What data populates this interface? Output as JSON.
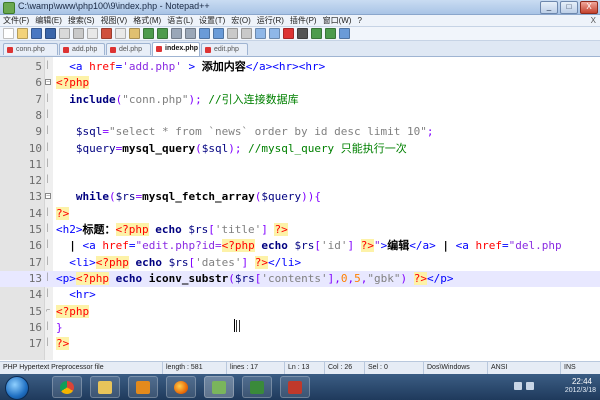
{
  "window": {
    "title": "C:\\wamp\\www\\php100\\9\\index.php - Notepad++",
    "buttons": {
      "minimize": "_",
      "maximize": "□",
      "close": "X"
    }
  },
  "menu": {
    "items": [
      "文件(F)",
      "编辑(E)",
      "搜索(S)",
      "视图(V)",
      "格式(M)",
      "语言(L)",
      "设置(T)",
      "宏(O)",
      "运行(R)",
      "插件(P)",
      "窗口(W)",
      "?"
    ],
    "close_label": "X"
  },
  "tabs": [
    {
      "label": "conn.php",
      "active": false
    },
    {
      "label": "add.php",
      "active": false
    },
    {
      "label": "del.php",
      "active": false
    },
    {
      "label": "index.php",
      "active": true
    },
    {
      "label": "edit.php",
      "active": false
    }
  ],
  "editor": {
    "current_line": 13,
    "lines": [
      {
        "n": "5",
        "segs": [
          [
            "t-tag",
            "  <a "
          ],
          [
            "t-attr",
            "href"
          ],
          [
            "t-tag",
            "="
          ],
          [
            "t-str",
            "'add.php'"
          ],
          [
            "t-tag",
            " > "
          ],
          [
            "t-txt",
            "添加内容"
          ],
          [
            "t-tag",
            "</a><hr><hr>"
          ]
        ]
      },
      {
        "n": "6",
        "segs": [
          [
            "t-php",
            "<?php"
          ]
        ]
      },
      {
        "n": "7",
        "segs": [
          [
            "t-kw",
            "  include"
          ],
          [
            "t-op",
            "("
          ],
          [
            "t-pstr",
            "\"conn.php\""
          ],
          [
            "t-op",
            ");"
          ],
          [
            "t-com",
            " //引入连接数据库"
          ]
        ]
      },
      {
        "n": "8",
        "segs": [
          [
            "",
            ""
          ]
        ]
      },
      {
        "n": "9",
        "segs": [
          [
            "t-var",
            "   $sql"
          ],
          [
            "t-op",
            "="
          ],
          [
            "t-pstr",
            "\"select * from `news` order by id desc limit 10\""
          ],
          [
            "t-op",
            ";"
          ]
        ]
      },
      {
        "n": "10",
        "segs": [
          [
            "t-var",
            "   $query"
          ],
          [
            "t-op",
            "="
          ],
          [
            "t-fn",
            "mysql_query"
          ],
          [
            "t-op",
            "("
          ],
          [
            "t-var",
            "$sql"
          ],
          [
            "t-op",
            ");"
          ],
          [
            "t-com",
            " //mysql_query 只能执行一次"
          ]
        ]
      },
      {
        "n": "11",
        "segs": [
          [
            "",
            ""
          ]
        ]
      },
      {
        "n": "12",
        "segs": [
          [
            "",
            ""
          ]
        ]
      },
      {
        "n": "13",
        "segs": [
          [
            "t-kw",
            "   while"
          ],
          [
            "t-op",
            "("
          ],
          [
            "t-var",
            "$rs"
          ],
          [
            "t-op",
            "="
          ],
          [
            "t-fn",
            "mysql_fetch_array"
          ],
          [
            "t-op",
            "("
          ],
          [
            "t-var",
            "$query"
          ],
          [
            "t-op",
            ")){"
          ]
        ]
      },
      {
        "n": "14",
        "segs": [
          [
            "t-php",
            "?>"
          ]
        ]
      },
      {
        "n": "15",
        "segs": [
          [
            "t-tag",
            "<h2>"
          ],
          [
            "t-txt",
            "标题："
          ],
          [
            "t-php",
            "<?php"
          ],
          [
            "t-kw",
            " echo "
          ],
          [
            "t-var",
            "$rs"
          ],
          [
            "t-op",
            "["
          ],
          [
            "t-pstr",
            "'title'"
          ],
          [
            "t-op",
            "] "
          ],
          [
            "t-php",
            "?>"
          ]
        ]
      },
      {
        "n": "16",
        "segs": [
          [
            "t-txt",
            "  | "
          ],
          [
            "t-tag",
            "<a "
          ],
          [
            "t-attr",
            "href"
          ],
          [
            "t-tag",
            "="
          ],
          [
            "t-str",
            "\"edit.php?id="
          ],
          [
            "t-php",
            "<?php"
          ],
          [
            "t-kw",
            " echo "
          ],
          [
            "t-var",
            "$rs"
          ],
          [
            "t-op",
            "["
          ],
          [
            "t-pstr",
            "'id'"
          ],
          [
            "t-op",
            "] "
          ],
          [
            "t-php",
            "?>"
          ],
          [
            "t-str",
            "\""
          ],
          [
            "t-tag",
            ">"
          ],
          [
            "t-txt",
            "编辑"
          ],
          [
            "t-tag",
            "</a>"
          ],
          [
            "t-txt",
            " | "
          ],
          [
            "t-tag",
            "<a "
          ],
          [
            "t-attr",
            "href"
          ],
          [
            "t-tag",
            "="
          ],
          [
            "t-str",
            "\"del.php"
          ]
        ]
      },
      {
        "n": "17",
        "segs": [
          [
            "t-tag",
            "  <li>"
          ],
          [
            "t-php",
            "<?php"
          ],
          [
            "t-kw",
            " echo "
          ],
          [
            "t-var",
            "$rs"
          ],
          [
            "t-op",
            "["
          ],
          [
            "t-pstr",
            "'dates'"
          ],
          [
            "t-op",
            "] "
          ],
          [
            "t-php",
            "?>"
          ],
          [
            "t-tag",
            "</li>"
          ]
        ]
      },
      {
        "n": "13",
        "segs": [
          [
            "t-tag",
            "<p>"
          ],
          [
            "t-php",
            "<?php"
          ],
          [
            "t-kw",
            " echo "
          ],
          [
            "t-fn",
            "iconv_substr"
          ],
          [
            "t-op",
            "("
          ],
          [
            "t-var",
            "$rs"
          ],
          [
            "t-op",
            "["
          ],
          [
            "t-pstr",
            "'contents'"
          ],
          [
            "t-op",
            "],"
          ],
          [
            "t-num",
            "0"
          ],
          [
            "t-op",
            ","
          ],
          [
            "t-num",
            "5"
          ],
          [
            "t-op",
            ","
          ],
          [
            "t-pstr",
            "\"gbk\""
          ],
          [
            "t-op",
            ") "
          ],
          [
            "t-php",
            "?>"
          ],
          [
            "t-tag",
            "</p>"
          ]
        ]
      },
      {
        "n": "14",
        "segs": [
          [
            "t-tag",
            "  <hr>"
          ]
        ]
      },
      {
        "n": "15",
        "segs": [
          [
            "t-php",
            "<?php"
          ]
        ]
      },
      {
        "n": "16",
        "segs": [
          [
            "t-op",
            "}"
          ]
        ]
      },
      {
        "n": "17",
        "segs": [
          [
            "t-php",
            "?>"
          ]
        ]
      }
    ]
  },
  "status": {
    "file_type": "PHP Hypertext Preprocessor file",
    "length": "length : 581",
    "lines": "lines : 17",
    "ln": "Ln : 13",
    "col": "Col : 26",
    "sel": "Sel : 0",
    "eol": "Dos\\Windows",
    "encoding": "ANSI",
    "mode": "INS"
  },
  "taskbar": {
    "time": "22:44",
    "date": "2012/3/18"
  }
}
